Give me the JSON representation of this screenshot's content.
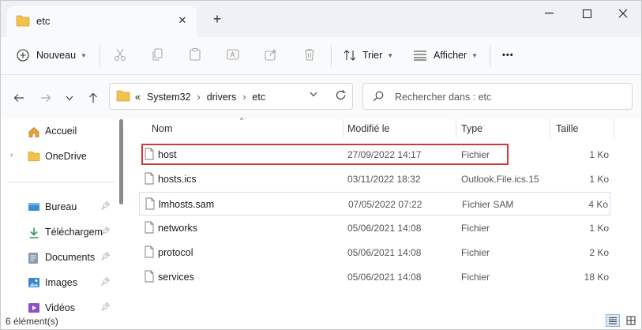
{
  "window": {
    "tab_title": "etc",
    "tab_close": "✕",
    "new_tab": "+",
    "minimize": "—",
    "maximize": "☐",
    "close": "✕"
  },
  "toolbar": {
    "new_label": "Nouveau",
    "sort_label": "Trier",
    "view_label": "Afficher",
    "more": "•••"
  },
  "address": {
    "overflow": "«",
    "crumbs": [
      "System32",
      "drivers",
      "etc"
    ],
    "separator": "›",
    "search_placeholder": "Rechercher dans : etc"
  },
  "sidebar": {
    "items": [
      {
        "label": "Accueil",
        "icon": "home-icon"
      },
      {
        "label": "OneDrive",
        "icon": "folder-icon"
      },
      {
        "label": "Bureau",
        "icon": "desktop-icon"
      },
      {
        "label": "Téléchargem",
        "icon": "download-icon"
      },
      {
        "label": "Documents",
        "icon": "documents-icon"
      },
      {
        "label": "Images",
        "icon": "images-icon"
      },
      {
        "label": "Vidéos",
        "icon": "videos-icon"
      }
    ]
  },
  "columns": {
    "name": "Nom",
    "modified": "Modifié le",
    "type": "Type",
    "size": "Taille"
  },
  "files": [
    {
      "name": "host",
      "modified": "27/09/2022 14:17",
      "type": "Fichier",
      "size": "1 Ko"
    },
    {
      "name": "hosts.ics",
      "modified": "03/11/2022 18:32",
      "type": "Outlook.File.ics.15",
      "size": "1 Ko"
    },
    {
      "name": "lmhosts.sam",
      "modified": "07/05/2022 07:22",
      "type": "Fichier SAM",
      "size": "4 Ko"
    },
    {
      "name": "networks",
      "modified": "05/06/2021 14:08",
      "type": "Fichier",
      "size": "1 Ko"
    },
    {
      "name": "protocol",
      "modified": "05/06/2021 14:08",
      "type": "Fichier",
      "size": "2 Ko"
    },
    {
      "name": "services",
      "modified": "05/06/2021 14:08",
      "type": "Fichier",
      "size": "18 Ko"
    }
  ],
  "status": {
    "count": "6 élément(s)"
  },
  "colors": {
    "accent": "#0067c0",
    "folder": "#f2c14e",
    "highlight": "#d0393c"
  }
}
